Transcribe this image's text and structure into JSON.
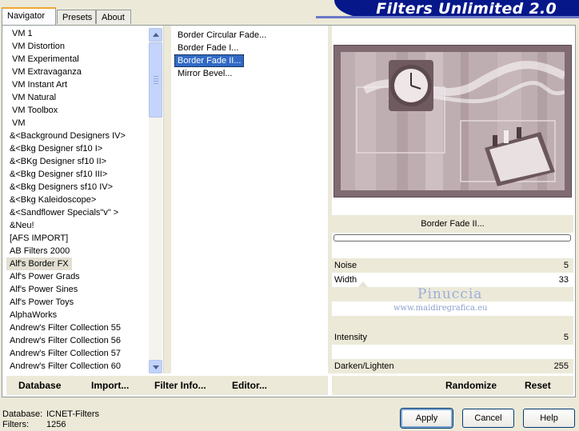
{
  "tabs": [
    "Navigator",
    "Presets",
    "About"
  ],
  "app_title": "Filters Unlimited 2.0",
  "categories": [
    "VM 1",
    "VM Distortion",
    "VM Experimental",
    "VM Extravaganza",
    "VM Instant Art",
    "VM Natural",
    "VM Toolbox",
    "VM",
    "&<Background Designers IV>",
    "&<Bkg Designer sf10 I>",
    "&<BKg Designer sf10 II>",
    "&<Bkg Designer sf10 III>",
    "&<Bkg Designers sf10 IV>",
    "&<Bkg Kaleidoscope>",
    "&<Sandflower Specials\"v\" >",
    "&Neu!",
    "[AFS IMPORT]",
    "AB Filters 2000",
    "Alf's Border FX",
    "Alf's Power Grads",
    "Alf's Power Sines",
    "Alf's Power Toys",
    "AlphaWorks",
    "Andrew's Filter Collection 55",
    "Andrew's Filter Collection 56",
    "Andrew's Filter Collection 57",
    "Andrew's Filter Collection 60"
  ],
  "selected_category": "Alf's Border FX",
  "filters": [
    "Border Circular Fade...",
    "Border Fade I...",
    "Border Fade II...",
    "Mirror Bevel..."
  ],
  "selected_filter": "Border Fade II...",
  "filter_name": "Border Fade II...",
  "params": [
    {
      "label": "Noise",
      "value": "5"
    },
    {
      "label": "Width",
      "value": "33"
    },
    {
      "label": "Intensity",
      "value": "5"
    },
    {
      "label": "Darken/Lighten",
      "value": "255"
    }
  ],
  "watermark": {
    "name": "Pinuccia",
    "url": "www.maidiregrafica.eu"
  },
  "toolbar": {
    "database": "Database",
    "import": "Import...",
    "filter_info": "Filter Info...",
    "editor": "Editor...",
    "randomize": "Randomize",
    "reset": "Reset"
  },
  "footer": {
    "database_label": "Database:",
    "database_value": "ICNET-Filters",
    "filters_label": "Filters:",
    "filters_value": "1256"
  },
  "dialog_buttons": {
    "apply": "Apply",
    "cancel": "Cancel",
    "help": "Help"
  }
}
